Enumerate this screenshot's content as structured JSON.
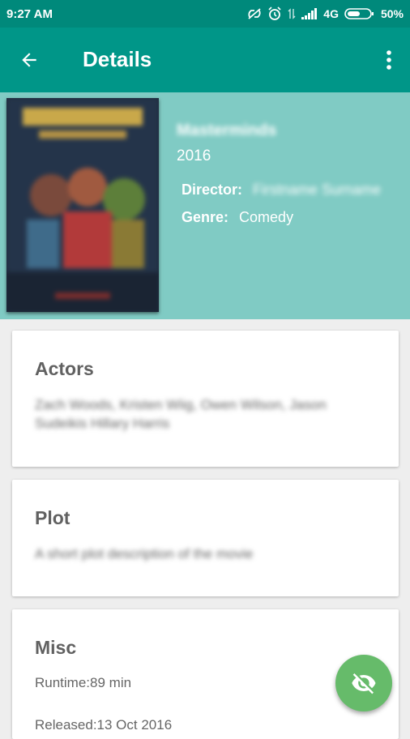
{
  "status_bar": {
    "time": "9:27 AM",
    "network": "4G",
    "battery": "50%",
    "icons": [
      "sync-off-icon",
      "alarm-icon",
      "data-arrows-icon",
      "signal-icon",
      "battery-icon"
    ]
  },
  "app_bar": {
    "title": "Details",
    "back_icon": "arrow-back-icon",
    "menu_icon": "more-vert-icon"
  },
  "movie": {
    "title": "Masterminds",
    "year": "2016",
    "director_label": "Director:",
    "director": "Firstname Surname",
    "genre_label": "Genre:",
    "genre": "Comedy"
  },
  "actors": {
    "title": "Actors",
    "text": "Zach Woods, Kristen Wiig, Owen Wilson, Jason Sudeikis Hillary Harris"
  },
  "plot": {
    "title": "Plot",
    "text": "A short plot description of the movie"
  },
  "misc": {
    "title": "Misc",
    "runtime": "Runtime:89 min",
    "released": "Released:13 Oct 2016"
  },
  "fab": {
    "icon": "eye-off-icon"
  },
  "colors": {
    "status_bar": "#00897b",
    "app_bar": "#009688",
    "hero": "#80cbc4",
    "fab": "#66bb6a"
  }
}
